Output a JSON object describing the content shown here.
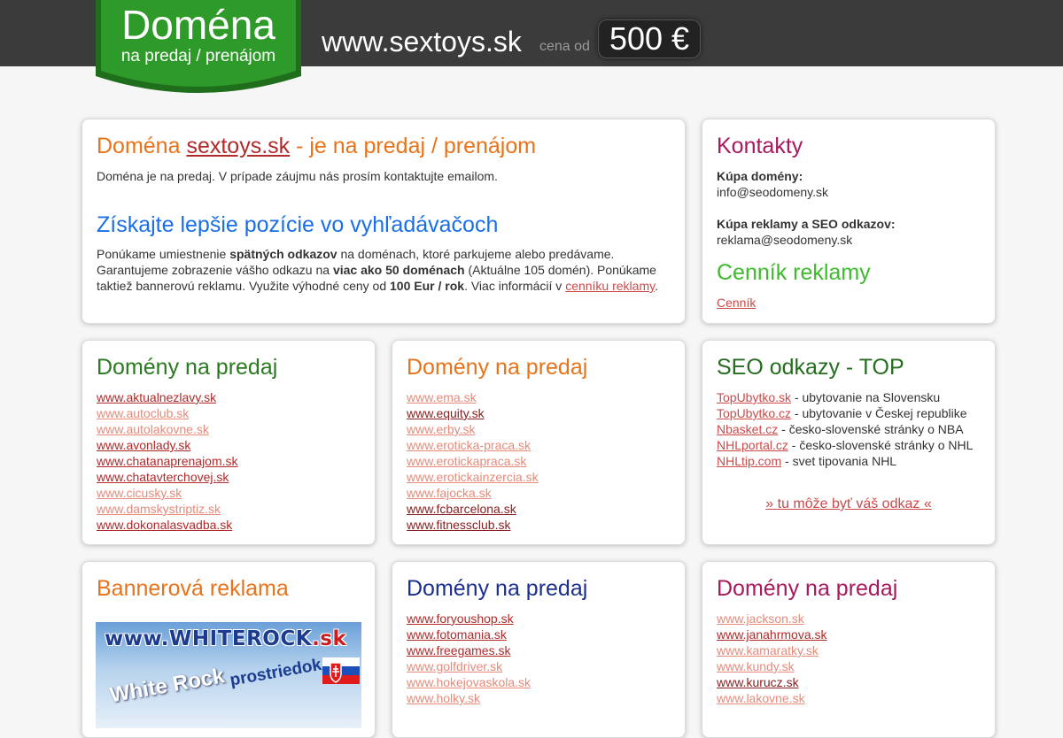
{
  "header": {
    "badge_title": "Doména",
    "badge_subtitle": "na predaj / prenájom",
    "domain": "www.sextoys.sk",
    "price_prefix": "cena od",
    "price": "500 €"
  },
  "intro": {
    "title_prefix": "Doména ",
    "title_link": "sextoys.sk",
    "title_suffix": " - je na predaj / prenájom",
    "text": "Doména je na predaj. V prípade záujmu nás prosím kontaktujte emailom.",
    "seo_title": "Získajte lepšie pozície vo vyhľadávačoch",
    "seo_t1": "Ponúkame umiestnenie ",
    "seo_b1": "spätných odkazov",
    "seo_t2": " na doménach, ktoré parkujeme alebo predávame. Garantujeme zobrazenie vášho odkazu na ",
    "seo_b2": "viac ako 50 doménach",
    "seo_t3": " (Aktuálne 105 domén). Ponúkame taktiež bannerovú reklamu. Využite výhodné ceny od ",
    "seo_b3": "100 Eur / rok",
    "seo_t4": ". Viac informácií v ",
    "seo_link": "cenníku reklamy",
    "seo_t5": "."
  },
  "contacts": {
    "title": "Kontakty",
    "buy_label": "Kúpa domény:",
    "buy_email": "info@seodomeny.sk",
    "ads_label": "Kúpa reklamy a SEO odkazov:",
    "ads_email": "reklama@seodomeny.sk",
    "pricing_title": "Cenník reklamy",
    "pricing_link": "Cenník"
  },
  "sale1": {
    "title": "Domény na predaj",
    "items": [
      "www.aktualnezlavy.sk",
      "www.autoclub.sk",
      "www.autolakovne.sk",
      "www.avonlady.sk",
      "www.chatanaprenajom.sk",
      "www.chatavterchovej.sk",
      "www.cicusky.sk",
      "www.damskystriptiz.sk",
      "www.dokonalasvadba.sk"
    ]
  },
  "sale2": {
    "title": "Domény na predaj",
    "items": [
      "www.ema.sk",
      "www.equity.sk",
      "www.erby.sk",
      "www.eroticka-praca.sk",
      "www.erotickapraca.sk",
      "www.erotickainzercia.sk",
      "www.fajocka.sk",
      "www.fcbarcelona.sk",
      "www.fitnessclub.sk"
    ]
  },
  "seo": {
    "title": "SEO odkazy - TOP",
    "items": [
      {
        "link": "TopUbytko.sk",
        "desc": " - ubytovanie na Slovensku"
      },
      {
        "link": "TopUbytko.cz",
        "desc": " - ubytovanie v Českej republike"
      },
      {
        "link": "Nbasket.cz",
        "desc": " - česko-slovenské stránky o NBA"
      },
      {
        "link": "NHLportal.cz",
        "desc": " - česko-slovenské stránky o NHL"
      },
      {
        "link": "NHLtip.com",
        "desc": " - svet tipovania NHL"
      }
    ],
    "cta": "» tu môže byť váš odkaz «"
  },
  "banner_card": {
    "title": "Bannerová reklama",
    "banner_url_main": "www.WHITEROCK",
    "banner_url_tld": ".sk",
    "banner_title": "White Rock",
    "banner_sub": "prostriedok"
  },
  "sale3": {
    "title": "Domény na predaj",
    "items": [
      "www.foryoushop.sk",
      "www.fotomania.sk",
      "www.freegames.sk",
      "www.golfdriver.sk",
      "www.hokejovaskola.sk",
      "www.holky.sk"
    ]
  },
  "sale4": {
    "title": "Domény na predaj",
    "items": [
      "www.jackson.sk",
      "www.janahrmova.sk",
      "www.kamaratky.sk",
      "www.kundy.sk",
      "www.kurucz.sk",
      "www.lakovne.sk"
    ]
  },
  "colors": {
    "topbar": "#3b3b3b",
    "badge_green": "#2e9a2a",
    "link": "#cc4a4a"
  }
}
